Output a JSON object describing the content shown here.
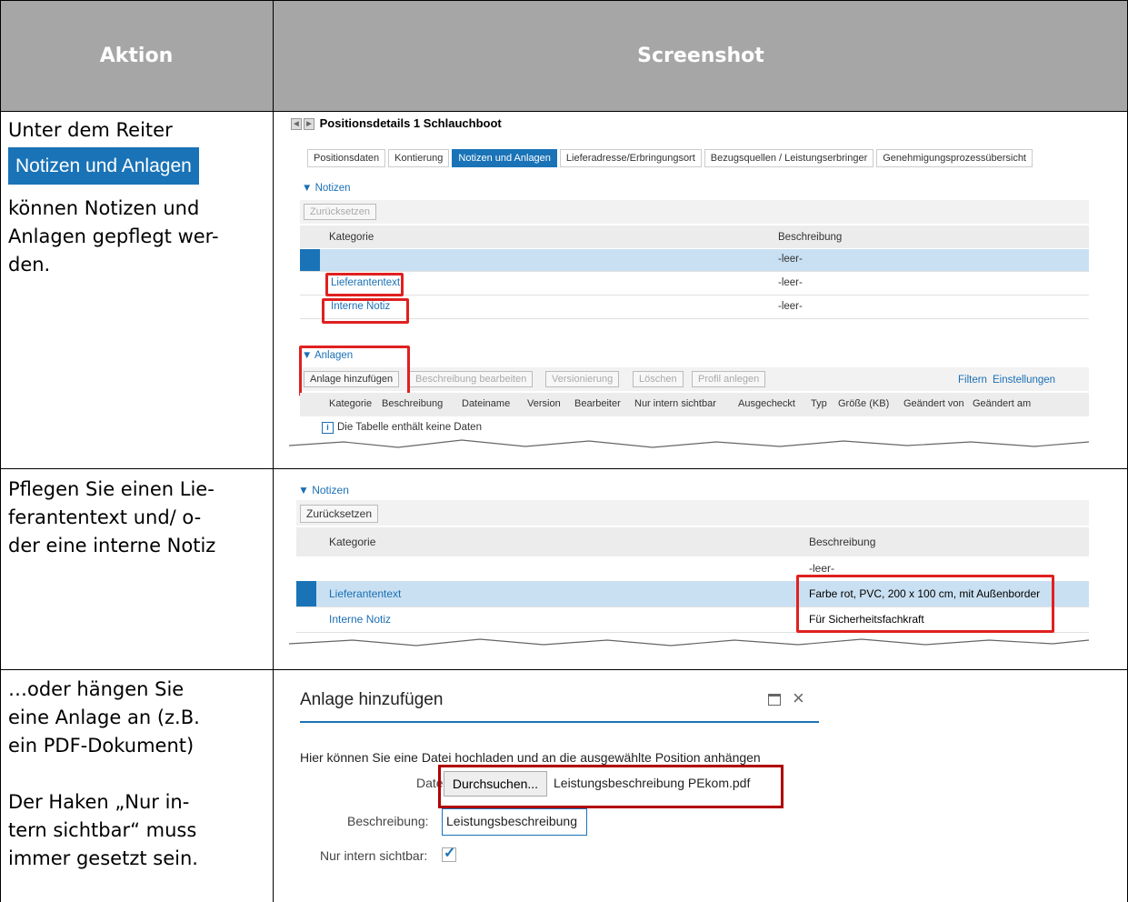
{
  "header": {
    "col1": "Aktion",
    "col2": "Screenshot"
  },
  "row1": {
    "text_before": "Unter dem Reiter",
    "chip": "Notizen und Anlagen",
    "text_after_1": "können Notizen und",
    "text_after_2": "Anlagen gepflegt wer-",
    "text_after_3": "den.",
    "shot": {
      "title": "Positionsdetails 1  Schlauchboot",
      "tabs": [
        "Positionsdaten",
        "Kontierung",
        "Notizen und Anlagen",
        "Lieferadresse/Erbringungsort",
        "Bezugsquellen / Leistungserbringer",
        "Genehmigungsprozessübersicht"
      ],
      "notes_toggle": "Notizen",
      "reset": "Zurücksetzen",
      "col_kategorie": "Kategorie",
      "col_beschreibung": "Beschreibung",
      "rows": [
        {
          "kategorie": "",
          "beschreibung": "-leer-"
        },
        {
          "kategorie": "Lieferantentext",
          "beschreibung": "-leer-"
        },
        {
          "kategorie": "Interne Notiz",
          "beschreibung": "-leer-"
        }
      ],
      "attach_toggle": "Anlagen",
      "attach_buttons": [
        "Anlage hinzufügen",
        "Beschreibung bearbeiten",
        "Versionierung",
        "Löschen",
        "Profil anlegen"
      ],
      "filter": "Filtern",
      "settings": "Einstellungen",
      "attach_cols": [
        "Kategorie",
        "Beschreibung",
        "Dateiname",
        "Version",
        "Bearbeiter",
        "Nur intern sichtbar",
        "Ausgecheckt",
        "Typ",
        "Größe (KB)",
        "Geändert von",
        "Geändert am"
      ],
      "empty": "Die Tabelle enthält keine Daten"
    }
  },
  "row2": {
    "line1": "Pflegen Sie einen Lie-",
    "line2": "ferantentext und/ o-",
    "line3": "der eine interne Notiz",
    "shot": {
      "notes_toggle": "Notizen",
      "reset": "Zurücksetzen",
      "col_kategorie": "Kategorie",
      "col_beschreibung": "Beschreibung",
      "rows": [
        {
          "kategorie": "",
          "beschreibung": "-leer-"
        },
        {
          "kategorie": "Lieferantentext",
          "beschreibung": "Farbe rot, PVC, 200 x 100 cm, mit Außenborder"
        },
        {
          "kategorie": "Interne Notiz",
          "beschreibung": "Für Sicherheitsfachkraft"
        }
      ]
    }
  },
  "row3": {
    "line1": "…oder hängen Sie",
    "line2": "eine Anlage an (z.B.",
    "line3": "ein PDF-Dokument)",
    "line4": "Der Haken „Nur in-",
    "line5": "tern sichtbar“ muss",
    "line6": "immer gesetzt sein.",
    "dialog": {
      "title": "Anlage hinzufügen",
      "intro": "Hier können Sie eine Datei hochladen und an die ausgewählte Position anhängen",
      "file_label": "Datei:",
      "browse": "Durchsuchen...",
      "file_name": "Leistungsbeschreibung PEkom.pdf",
      "desc_label": "Beschreibung:",
      "desc_value": "Leistungsbeschreibung",
      "internal_label": "Nur intern sichtbar:"
    }
  },
  "colors": {
    "header_bg": "#a6a6a6",
    "accent": "#1a73b7",
    "highlight": "#e02020"
  }
}
